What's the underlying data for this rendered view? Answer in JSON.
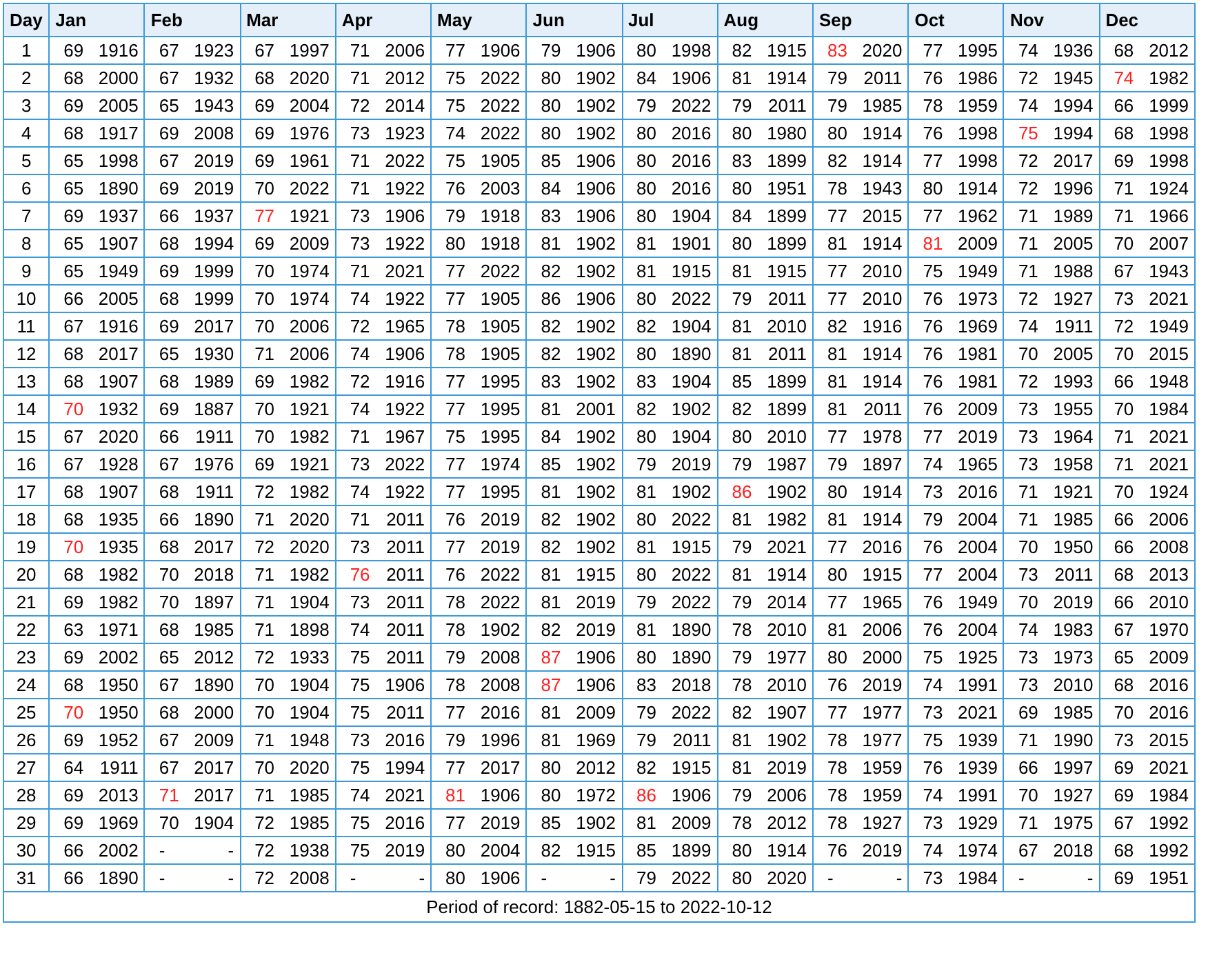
{
  "columns": [
    "Day",
    "Jan",
    "Feb",
    "Mar",
    "Apr",
    "May",
    "Jun",
    "Jul",
    "Aug",
    "Sep",
    "Oct",
    "Nov",
    "Dec"
  ],
  "rows": [
    {
      "day": "1",
      "cells": [
        {
          "temp": "69",
          "year": "1916",
          "record": false
        },
        {
          "temp": "67",
          "year": "1923",
          "record": false
        },
        {
          "temp": "67",
          "year": "1997",
          "record": false
        },
        {
          "temp": "71",
          "year": "2006",
          "record": false
        },
        {
          "temp": "77",
          "year": "1906",
          "record": false
        },
        {
          "temp": "79",
          "year": "1906",
          "record": false
        },
        {
          "temp": "80",
          "year": "1998",
          "record": false
        },
        {
          "temp": "82",
          "year": "1915",
          "record": false
        },
        {
          "temp": "83",
          "year": "2020",
          "record": true
        },
        {
          "temp": "77",
          "year": "1995",
          "record": false
        },
        {
          "temp": "74",
          "year": "1936",
          "record": false
        },
        {
          "temp": "68",
          "year": "2012",
          "record": false
        }
      ]
    },
    {
      "day": "2",
      "cells": [
        {
          "temp": "68",
          "year": "2000",
          "record": false
        },
        {
          "temp": "67",
          "year": "1932",
          "record": false
        },
        {
          "temp": "68",
          "year": "2020",
          "record": false
        },
        {
          "temp": "71",
          "year": "2012",
          "record": false
        },
        {
          "temp": "75",
          "year": "2022",
          "record": false
        },
        {
          "temp": "80",
          "year": "1902",
          "record": false
        },
        {
          "temp": "84",
          "year": "1906",
          "record": false
        },
        {
          "temp": "81",
          "year": "1914",
          "record": false
        },
        {
          "temp": "79",
          "year": "2011",
          "record": false
        },
        {
          "temp": "76",
          "year": "1986",
          "record": false
        },
        {
          "temp": "72",
          "year": "1945",
          "record": false
        },
        {
          "temp": "74",
          "year": "1982",
          "record": true
        }
      ]
    },
    {
      "day": "3",
      "cells": [
        {
          "temp": "69",
          "year": "2005",
          "record": false
        },
        {
          "temp": "65",
          "year": "1943",
          "record": false
        },
        {
          "temp": "69",
          "year": "2004",
          "record": false
        },
        {
          "temp": "72",
          "year": "2014",
          "record": false
        },
        {
          "temp": "75",
          "year": "2022",
          "record": false
        },
        {
          "temp": "80",
          "year": "1902",
          "record": false
        },
        {
          "temp": "79",
          "year": "2022",
          "record": false
        },
        {
          "temp": "79",
          "year": "2011",
          "record": false
        },
        {
          "temp": "79",
          "year": "1985",
          "record": false
        },
        {
          "temp": "78",
          "year": "1959",
          "record": false
        },
        {
          "temp": "74",
          "year": "1994",
          "record": false
        },
        {
          "temp": "66",
          "year": "1999",
          "record": false
        }
      ]
    },
    {
      "day": "4",
      "cells": [
        {
          "temp": "68",
          "year": "1917",
          "record": false
        },
        {
          "temp": "69",
          "year": "2008",
          "record": false
        },
        {
          "temp": "69",
          "year": "1976",
          "record": false
        },
        {
          "temp": "73",
          "year": "1923",
          "record": false
        },
        {
          "temp": "74",
          "year": "2022",
          "record": false
        },
        {
          "temp": "80",
          "year": "1902",
          "record": false
        },
        {
          "temp": "80",
          "year": "2016",
          "record": false
        },
        {
          "temp": "80",
          "year": "1980",
          "record": false
        },
        {
          "temp": "80",
          "year": "1914",
          "record": false
        },
        {
          "temp": "76",
          "year": "1998",
          "record": false
        },
        {
          "temp": "75",
          "year": "1994",
          "record": true
        },
        {
          "temp": "68",
          "year": "1998",
          "record": false
        }
      ]
    },
    {
      "day": "5",
      "cells": [
        {
          "temp": "65",
          "year": "1998",
          "record": false
        },
        {
          "temp": "67",
          "year": "2019",
          "record": false
        },
        {
          "temp": "69",
          "year": "1961",
          "record": false
        },
        {
          "temp": "71",
          "year": "2022",
          "record": false
        },
        {
          "temp": "75",
          "year": "1905",
          "record": false
        },
        {
          "temp": "85",
          "year": "1906",
          "record": false
        },
        {
          "temp": "80",
          "year": "2016",
          "record": false
        },
        {
          "temp": "83",
          "year": "1899",
          "record": false
        },
        {
          "temp": "82",
          "year": "1914",
          "record": false
        },
        {
          "temp": "77",
          "year": "1998",
          "record": false
        },
        {
          "temp": "72",
          "year": "2017",
          "record": false
        },
        {
          "temp": "69",
          "year": "1998",
          "record": false
        }
      ]
    },
    {
      "day": "6",
      "cells": [
        {
          "temp": "65",
          "year": "1890",
          "record": false
        },
        {
          "temp": "69",
          "year": "2019",
          "record": false
        },
        {
          "temp": "70",
          "year": "2022",
          "record": false
        },
        {
          "temp": "71",
          "year": "1922",
          "record": false
        },
        {
          "temp": "76",
          "year": "2003",
          "record": false
        },
        {
          "temp": "84",
          "year": "1906",
          "record": false
        },
        {
          "temp": "80",
          "year": "2016",
          "record": false
        },
        {
          "temp": "80",
          "year": "1951",
          "record": false
        },
        {
          "temp": "78",
          "year": "1943",
          "record": false
        },
        {
          "temp": "80",
          "year": "1914",
          "record": false
        },
        {
          "temp": "72",
          "year": "1996",
          "record": false
        },
        {
          "temp": "71",
          "year": "1924",
          "record": false
        }
      ]
    },
    {
      "day": "7",
      "cells": [
        {
          "temp": "69",
          "year": "1937",
          "record": false
        },
        {
          "temp": "66",
          "year": "1937",
          "record": false
        },
        {
          "temp": "77",
          "year": "1921",
          "record": true
        },
        {
          "temp": "73",
          "year": "1906",
          "record": false
        },
        {
          "temp": "79",
          "year": "1918",
          "record": false
        },
        {
          "temp": "83",
          "year": "1906",
          "record": false
        },
        {
          "temp": "80",
          "year": "1904",
          "record": false
        },
        {
          "temp": "84",
          "year": "1899",
          "record": false
        },
        {
          "temp": "77",
          "year": "2015",
          "record": false
        },
        {
          "temp": "77",
          "year": "1962",
          "record": false
        },
        {
          "temp": "71",
          "year": "1989",
          "record": false
        },
        {
          "temp": "71",
          "year": "1966",
          "record": false
        }
      ]
    },
    {
      "day": "8",
      "cells": [
        {
          "temp": "65",
          "year": "1907",
          "record": false
        },
        {
          "temp": "68",
          "year": "1994",
          "record": false
        },
        {
          "temp": "69",
          "year": "2009",
          "record": false
        },
        {
          "temp": "73",
          "year": "1922",
          "record": false
        },
        {
          "temp": "80",
          "year": "1918",
          "record": false
        },
        {
          "temp": "81",
          "year": "1902",
          "record": false
        },
        {
          "temp": "81",
          "year": "1901",
          "record": false
        },
        {
          "temp": "80",
          "year": "1899",
          "record": false
        },
        {
          "temp": "81",
          "year": "1914",
          "record": false
        },
        {
          "temp": "81",
          "year": "2009",
          "record": true
        },
        {
          "temp": "71",
          "year": "2005",
          "record": false
        },
        {
          "temp": "70",
          "year": "2007",
          "record": false
        }
      ]
    },
    {
      "day": "9",
      "cells": [
        {
          "temp": "65",
          "year": "1949",
          "record": false
        },
        {
          "temp": "69",
          "year": "1999",
          "record": false
        },
        {
          "temp": "70",
          "year": "1974",
          "record": false
        },
        {
          "temp": "71",
          "year": "2021",
          "record": false
        },
        {
          "temp": "77",
          "year": "2022",
          "record": false
        },
        {
          "temp": "82",
          "year": "1902",
          "record": false
        },
        {
          "temp": "81",
          "year": "1915",
          "record": false
        },
        {
          "temp": "81",
          "year": "1915",
          "record": false
        },
        {
          "temp": "77",
          "year": "2010",
          "record": false
        },
        {
          "temp": "75",
          "year": "1949",
          "record": false
        },
        {
          "temp": "71",
          "year": "1988",
          "record": false
        },
        {
          "temp": "67",
          "year": "1943",
          "record": false
        }
      ]
    },
    {
      "day": "10",
      "cells": [
        {
          "temp": "66",
          "year": "2005",
          "record": false
        },
        {
          "temp": "68",
          "year": "1999",
          "record": false
        },
        {
          "temp": "70",
          "year": "1974",
          "record": false
        },
        {
          "temp": "74",
          "year": "1922",
          "record": false
        },
        {
          "temp": "77",
          "year": "1905",
          "record": false
        },
        {
          "temp": "86",
          "year": "1906",
          "record": false
        },
        {
          "temp": "80",
          "year": "2022",
          "record": false
        },
        {
          "temp": "79",
          "year": "2011",
          "record": false
        },
        {
          "temp": "77",
          "year": "2010",
          "record": false
        },
        {
          "temp": "76",
          "year": "1973",
          "record": false
        },
        {
          "temp": "72",
          "year": "1927",
          "record": false
        },
        {
          "temp": "73",
          "year": "2021",
          "record": false
        }
      ]
    },
    {
      "day": "11",
      "cells": [
        {
          "temp": "67",
          "year": "1916",
          "record": false
        },
        {
          "temp": "69",
          "year": "2017",
          "record": false
        },
        {
          "temp": "70",
          "year": "2006",
          "record": false
        },
        {
          "temp": "72",
          "year": "1965",
          "record": false
        },
        {
          "temp": "78",
          "year": "1905",
          "record": false
        },
        {
          "temp": "82",
          "year": "1902",
          "record": false
        },
        {
          "temp": "82",
          "year": "1904",
          "record": false
        },
        {
          "temp": "81",
          "year": "2010",
          "record": false
        },
        {
          "temp": "82",
          "year": "1916",
          "record": false
        },
        {
          "temp": "76",
          "year": "1969",
          "record": false
        },
        {
          "temp": "74",
          "year": "1911",
          "record": false
        },
        {
          "temp": "72",
          "year": "1949",
          "record": false
        }
      ]
    },
    {
      "day": "12",
      "cells": [
        {
          "temp": "68",
          "year": "2017",
          "record": false
        },
        {
          "temp": "65",
          "year": "1930",
          "record": false
        },
        {
          "temp": "71",
          "year": "2006",
          "record": false
        },
        {
          "temp": "74",
          "year": "1906",
          "record": false
        },
        {
          "temp": "78",
          "year": "1905",
          "record": false
        },
        {
          "temp": "82",
          "year": "1902",
          "record": false
        },
        {
          "temp": "80",
          "year": "1890",
          "record": false
        },
        {
          "temp": "81",
          "year": "2011",
          "record": false
        },
        {
          "temp": "81",
          "year": "1914",
          "record": false
        },
        {
          "temp": "76",
          "year": "1981",
          "record": false
        },
        {
          "temp": "70",
          "year": "2005",
          "record": false
        },
        {
          "temp": "70",
          "year": "2015",
          "record": false
        }
      ]
    },
    {
      "day": "13",
      "cells": [
        {
          "temp": "68",
          "year": "1907",
          "record": false
        },
        {
          "temp": "68",
          "year": "1989",
          "record": false
        },
        {
          "temp": "69",
          "year": "1982",
          "record": false
        },
        {
          "temp": "72",
          "year": "1916",
          "record": false
        },
        {
          "temp": "77",
          "year": "1995",
          "record": false
        },
        {
          "temp": "83",
          "year": "1902",
          "record": false
        },
        {
          "temp": "83",
          "year": "1904",
          "record": false
        },
        {
          "temp": "85",
          "year": "1899",
          "record": false
        },
        {
          "temp": "81",
          "year": "1914",
          "record": false
        },
        {
          "temp": "76",
          "year": "1981",
          "record": false
        },
        {
          "temp": "72",
          "year": "1993",
          "record": false
        },
        {
          "temp": "66",
          "year": "1948",
          "record": false
        }
      ]
    },
    {
      "day": "14",
      "cells": [
        {
          "temp": "70",
          "year": "1932",
          "record": true
        },
        {
          "temp": "69",
          "year": "1887",
          "record": false
        },
        {
          "temp": "70",
          "year": "1921",
          "record": false
        },
        {
          "temp": "74",
          "year": "1922",
          "record": false
        },
        {
          "temp": "77",
          "year": "1995",
          "record": false
        },
        {
          "temp": "81",
          "year": "2001",
          "record": false
        },
        {
          "temp": "82",
          "year": "1902",
          "record": false
        },
        {
          "temp": "82",
          "year": "1899",
          "record": false
        },
        {
          "temp": "81",
          "year": "2011",
          "record": false
        },
        {
          "temp": "76",
          "year": "2009",
          "record": false
        },
        {
          "temp": "73",
          "year": "1955",
          "record": false
        },
        {
          "temp": "70",
          "year": "1984",
          "record": false
        }
      ]
    },
    {
      "day": "15",
      "cells": [
        {
          "temp": "67",
          "year": "2020",
          "record": false
        },
        {
          "temp": "66",
          "year": "1911",
          "record": false
        },
        {
          "temp": "70",
          "year": "1982",
          "record": false
        },
        {
          "temp": "71",
          "year": "1967",
          "record": false
        },
        {
          "temp": "75",
          "year": "1995",
          "record": false
        },
        {
          "temp": "84",
          "year": "1902",
          "record": false
        },
        {
          "temp": "80",
          "year": "1904",
          "record": false
        },
        {
          "temp": "80",
          "year": "2010",
          "record": false
        },
        {
          "temp": "77",
          "year": "1978",
          "record": false
        },
        {
          "temp": "77",
          "year": "2019",
          "record": false
        },
        {
          "temp": "73",
          "year": "1964",
          "record": false
        },
        {
          "temp": "71",
          "year": "2021",
          "record": false
        }
      ]
    },
    {
      "day": "16",
      "cells": [
        {
          "temp": "67",
          "year": "1928",
          "record": false
        },
        {
          "temp": "67",
          "year": "1976",
          "record": false
        },
        {
          "temp": "69",
          "year": "1921",
          "record": false
        },
        {
          "temp": "73",
          "year": "2022",
          "record": false
        },
        {
          "temp": "77",
          "year": "1974",
          "record": false
        },
        {
          "temp": "85",
          "year": "1902",
          "record": false
        },
        {
          "temp": "79",
          "year": "2019",
          "record": false
        },
        {
          "temp": "79",
          "year": "1987",
          "record": false
        },
        {
          "temp": "79",
          "year": "1897",
          "record": false
        },
        {
          "temp": "74",
          "year": "1965",
          "record": false
        },
        {
          "temp": "73",
          "year": "1958",
          "record": false
        },
        {
          "temp": "71",
          "year": "2021",
          "record": false
        }
      ]
    },
    {
      "day": "17",
      "cells": [
        {
          "temp": "68",
          "year": "1907",
          "record": false
        },
        {
          "temp": "68",
          "year": "1911",
          "record": false
        },
        {
          "temp": "72",
          "year": "1982",
          "record": false
        },
        {
          "temp": "74",
          "year": "1922",
          "record": false
        },
        {
          "temp": "77",
          "year": "1995",
          "record": false
        },
        {
          "temp": "81",
          "year": "1902",
          "record": false
        },
        {
          "temp": "81",
          "year": "1902",
          "record": false
        },
        {
          "temp": "86",
          "year": "1902",
          "record": true
        },
        {
          "temp": "80",
          "year": "1914",
          "record": false
        },
        {
          "temp": "73",
          "year": "2016",
          "record": false
        },
        {
          "temp": "71",
          "year": "1921",
          "record": false
        },
        {
          "temp": "70",
          "year": "1924",
          "record": false
        }
      ]
    },
    {
      "day": "18",
      "cells": [
        {
          "temp": "68",
          "year": "1935",
          "record": false
        },
        {
          "temp": "66",
          "year": "1890",
          "record": false
        },
        {
          "temp": "71",
          "year": "2020",
          "record": false
        },
        {
          "temp": "71",
          "year": "2011",
          "record": false
        },
        {
          "temp": "76",
          "year": "2019",
          "record": false
        },
        {
          "temp": "82",
          "year": "1902",
          "record": false
        },
        {
          "temp": "80",
          "year": "2022",
          "record": false
        },
        {
          "temp": "81",
          "year": "1982",
          "record": false
        },
        {
          "temp": "81",
          "year": "1914",
          "record": false
        },
        {
          "temp": "79",
          "year": "2004",
          "record": false
        },
        {
          "temp": "71",
          "year": "1985",
          "record": false
        },
        {
          "temp": "66",
          "year": "2006",
          "record": false
        }
      ]
    },
    {
      "day": "19",
      "cells": [
        {
          "temp": "70",
          "year": "1935",
          "record": true
        },
        {
          "temp": "68",
          "year": "2017",
          "record": false
        },
        {
          "temp": "72",
          "year": "2020",
          "record": false
        },
        {
          "temp": "73",
          "year": "2011",
          "record": false
        },
        {
          "temp": "77",
          "year": "2019",
          "record": false
        },
        {
          "temp": "82",
          "year": "1902",
          "record": false
        },
        {
          "temp": "81",
          "year": "1915",
          "record": false
        },
        {
          "temp": "79",
          "year": "2021",
          "record": false
        },
        {
          "temp": "77",
          "year": "2016",
          "record": false
        },
        {
          "temp": "76",
          "year": "2004",
          "record": false
        },
        {
          "temp": "70",
          "year": "1950",
          "record": false
        },
        {
          "temp": "66",
          "year": "2008",
          "record": false
        }
      ]
    },
    {
      "day": "20",
      "cells": [
        {
          "temp": "68",
          "year": "1982",
          "record": false
        },
        {
          "temp": "70",
          "year": "2018",
          "record": false
        },
        {
          "temp": "71",
          "year": "1982",
          "record": false
        },
        {
          "temp": "76",
          "year": "2011",
          "record": true
        },
        {
          "temp": "76",
          "year": "2022",
          "record": false
        },
        {
          "temp": "81",
          "year": "1915",
          "record": false
        },
        {
          "temp": "80",
          "year": "2022",
          "record": false
        },
        {
          "temp": "81",
          "year": "1914",
          "record": false
        },
        {
          "temp": "80",
          "year": "1915",
          "record": false
        },
        {
          "temp": "77",
          "year": "2004",
          "record": false
        },
        {
          "temp": "73",
          "year": "2011",
          "record": false
        },
        {
          "temp": "68",
          "year": "2013",
          "record": false
        }
      ]
    },
    {
      "day": "21",
      "cells": [
        {
          "temp": "69",
          "year": "1982",
          "record": false
        },
        {
          "temp": "70",
          "year": "1897",
          "record": false
        },
        {
          "temp": "71",
          "year": "1904",
          "record": false
        },
        {
          "temp": "73",
          "year": "2011",
          "record": false
        },
        {
          "temp": "78",
          "year": "2022",
          "record": false
        },
        {
          "temp": "81",
          "year": "2019",
          "record": false
        },
        {
          "temp": "79",
          "year": "2022",
          "record": false
        },
        {
          "temp": "79",
          "year": "2014",
          "record": false
        },
        {
          "temp": "77",
          "year": "1965",
          "record": false
        },
        {
          "temp": "76",
          "year": "1949",
          "record": false
        },
        {
          "temp": "70",
          "year": "2019",
          "record": false
        },
        {
          "temp": "66",
          "year": "2010",
          "record": false
        }
      ]
    },
    {
      "day": "22",
      "cells": [
        {
          "temp": "63",
          "year": "1971",
          "record": false
        },
        {
          "temp": "68",
          "year": "1985",
          "record": false
        },
        {
          "temp": "71",
          "year": "1898",
          "record": false
        },
        {
          "temp": "74",
          "year": "2011",
          "record": false
        },
        {
          "temp": "78",
          "year": "1902",
          "record": false
        },
        {
          "temp": "82",
          "year": "2019",
          "record": false
        },
        {
          "temp": "81",
          "year": "1890",
          "record": false
        },
        {
          "temp": "78",
          "year": "2010",
          "record": false
        },
        {
          "temp": "81",
          "year": "2006",
          "record": false
        },
        {
          "temp": "76",
          "year": "2004",
          "record": false
        },
        {
          "temp": "74",
          "year": "1983",
          "record": false
        },
        {
          "temp": "67",
          "year": "1970",
          "record": false
        }
      ]
    },
    {
      "day": "23",
      "cells": [
        {
          "temp": "69",
          "year": "2002",
          "record": false
        },
        {
          "temp": "65",
          "year": "2012",
          "record": false
        },
        {
          "temp": "72",
          "year": "1933",
          "record": false
        },
        {
          "temp": "75",
          "year": "2011",
          "record": false
        },
        {
          "temp": "79",
          "year": "2008",
          "record": false
        },
        {
          "temp": "87",
          "year": "1906",
          "record": true
        },
        {
          "temp": "80",
          "year": "1890",
          "record": false
        },
        {
          "temp": "79",
          "year": "1977",
          "record": false
        },
        {
          "temp": "80",
          "year": "2000",
          "record": false
        },
        {
          "temp": "75",
          "year": "1925",
          "record": false
        },
        {
          "temp": "73",
          "year": "1973",
          "record": false
        },
        {
          "temp": "65",
          "year": "2009",
          "record": false
        }
      ]
    },
    {
      "day": "24",
      "cells": [
        {
          "temp": "68",
          "year": "1950",
          "record": false
        },
        {
          "temp": "67",
          "year": "1890",
          "record": false
        },
        {
          "temp": "70",
          "year": "1904",
          "record": false
        },
        {
          "temp": "75",
          "year": "1906",
          "record": false
        },
        {
          "temp": "78",
          "year": "2008",
          "record": false
        },
        {
          "temp": "87",
          "year": "1906",
          "record": true
        },
        {
          "temp": "83",
          "year": "2018",
          "record": false
        },
        {
          "temp": "78",
          "year": "2010",
          "record": false
        },
        {
          "temp": "76",
          "year": "2019",
          "record": false
        },
        {
          "temp": "74",
          "year": "1991",
          "record": false
        },
        {
          "temp": "73",
          "year": "2010",
          "record": false
        },
        {
          "temp": "68",
          "year": "2016",
          "record": false
        }
      ]
    },
    {
      "day": "25",
      "cells": [
        {
          "temp": "70",
          "year": "1950",
          "record": true
        },
        {
          "temp": "68",
          "year": "2000",
          "record": false
        },
        {
          "temp": "70",
          "year": "1904",
          "record": false
        },
        {
          "temp": "75",
          "year": "2011",
          "record": false
        },
        {
          "temp": "77",
          "year": "2016",
          "record": false
        },
        {
          "temp": "81",
          "year": "2009",
          "record": false
        },
        {
          "temp": "79",
          "year": "2022",
          "record": false
        },
        {
          "temp": "82",
          "year": "1907",
          "record": false
        },
        {
          "temp": "77",
          "year": "1977",
          "record": false
        },
        {
          "temp": "73",
          "year": "2021",
          "record": false
        },
        {
          "temp": "69",
          "year": "1985",
          "record": false
        },
        {
          "temp": "70",
          "year": "2016",
          "record": false
        }
      ]
    },
    {
      "day": "26",
      "cells": [
        {
          "temp": "69",
          "year": "1952",
          "record": false
        },
        {
          "temp": "67",
          "year": "2009",
          "record": false
        },
        {
          "temp": "71",
          "year": "1948",
          "record": false
        },
        {
          "temp": "73",
          "year": "2016",
          "record": false
        },
        {
          "temp": "79",
          "year": "1996",
          "record": false
        },
        {
          "temp": "81",
          "year": "1969",
          "record": false
        },
        {
          "temp": "79",
          "year": "2011",
          "record": false
        },
        {
          "temp": "81",
          "year": "1902",
          "record": false
        },
        {
          "temp": "78",
          "year": "1977",
          "record": false
        },
        {
          "temp": "75",
          "year": "1939",
          "record": false
        },
        {
          "temp": "71",
          "year": "1990",
          "record": false
        },
        {
          "temp": "73",
          "year": "2015",
          "record": false
        }
      ]
    },
    {
      "day": "27",
      "cells": [
        {
          "temp": "64",
          "year": "1911",
          "record": false
        },
        {
          "temp": "67",
          "year": "2017",
          "record": false
        },
        {
          "temp": "70",
          "year": "2020",
          "record": false
        },
        {
          "temp": "75",
          "year": "1994",
          "record": false
        },
        {
          "temp": "77",
          "year": "2017",
          "record": false
        },
        {
          "temp": "80",
          "year": "2012",
          "record": false
        },
        {
          "temp": "82",
          "year": "1915",
          "record": false
        },
        {
          "temp": "81",
          "year": "2019",
          "record": false
        },
        {
          "temp": "78",
          "year": "1959",
          "record": false
        },
        {
          "temp": "76",
          "year": "1939",
          "record": false
        },
        {
          "temp": "66",
          "year": "1997",
          "record": false
        },
        {
          "temp": "69",
          "year": "2021",
          "record": false
        }
      ]
    },
    {
      "day": "28",
      "cells": [
        {
          "temp": "69",
          "year": "2013",
          "record": false
        },
        {
          "temp": "71",
          "year": "2017",
          "record": true
        },
        {
          "temp": "71",
          "year": "1985",
          "record": false
        },
        {
          "temp": "74",
          "year": "2021",
          "record": false
        },
        {
          "temp": "81",
          "year": "1906",
          "record": true
        },
        {
          "temp": "80",
          "year": "1972",
          "record": false
        },
        {
          "temp": "86",
          "year": "1906",
          "record": true
        },
        {
          "temp": "79",
          "year": "2006",
          "record": false
        },
        {
          "temp": "78",
          "year": "1959",
          "record": false
        },
        {
          "temp": "74",
          "year": "1991",
          "record": false
        },
        {
          "temp": "70",
          "year": "1927",
          "record": false
        },
        {
          "temp": "69",
          "year": "1984",
          "record": false
        }
      ]
    },
    {
      "day": "29",
      "cells": [
        {
          "temp": "69",
          "year": "1969",
          "record": false
        },
        {
          "temp": "70",
          "year": "1904",
          "record": false
        },
        {
          "temp": "72",
          "year": "1985",
          "record": false
        },
        {
          "temp": "75",
          "year": "2016",
          "record": false
        },
        {
          "temp": "77",
          "year": "2019",
          "record": false
        },
        {
          "temp": "85",
          "year": "1902",
          "record": false
        },
        {
          "temp": "81",
          "year": "2009",
          "record": false
        },
        {
          "temp": "78",
          "year": "2012",
          "record": false
        },
        {
          "temp": "78",
          "year": "1927",
          "record": false
        },
        {
          "temp": "73",
          "year": "1929",
          "record": false
        },
        {
          "temp": "71",
          "year": "1975",
          "record": false
        },
        {
          "temp": "67",
          "year": "1992",
          "record": false
        }
      ]
    },
    {
      "day": "30",
      "cells": [
        {
          "temp": "66",
          "year": "2002",
          "record": false
        },
        {
          "temp": "-",
          "year": "-",
          "record": false
        },
        {
          "temp": "72",
          "year": "1938",
          "record": false
        },
        {
          "temp": "75",
          "year": "2019",
          "record": false
        },
        {
          "temp": "80",
          "year": "2004",
          "record": false
        },
        {
          "temp": "82",
          "year": "1915",
          "record": false
        },
        {
          "temp": "85",
          "year": "1899",
          "record": false
        },
        {
          "temp": "80",
          "year": "1914",
          "record": false
        },
        {
          "temp": "76",
          "year": "2019",
          "record": false
        },
        {
          "temp": "74",
          "year": "1974",
          "record": false
        },
        {
          "temp": "67",
          "year": "2018",
          "record": false
        },
        {
          "temp": "68",
          "year": "1992",
          "record": false
        }
      ]
    },
    {
      "day": "31",
      "cells": [
        {
          "temp": "66",
          "year": "1890",
          "record": false
        },
        {
          "temp": "-",
          "year": "-",
          "record": false
        },
        {
          "temp": "72",
          "year": "2008",
          "record": false
        },
        {
          "temp": "-",
          "year": "-",
          "record": false
        },
        {
          "temp": "80",
          "year": "1906",
          "record": false
        },
        {
          "temp": "-",
          "year": "-",
          "record": false
        },
        {
          "temp": "79",
          "year": "2022",
          "record": false
        },
        {
          "temp": "80",
          "year": "2020",
          "record": false
        },
        {
          "temp": "-",
          "year": "-",
          "record": false
        },
        {
          "temp": "73",
          "year": "1984",
          "record": false
        },
        {
          "temp": "-",
          "year": "-",
          "record": false
        },
        {
          "temp": "69",
          "year": "1951",
          "record": false
        }
      ]
    }
  ],
  "footer": "Period of record: 1882-05-15 to 2022-10-12"
}
